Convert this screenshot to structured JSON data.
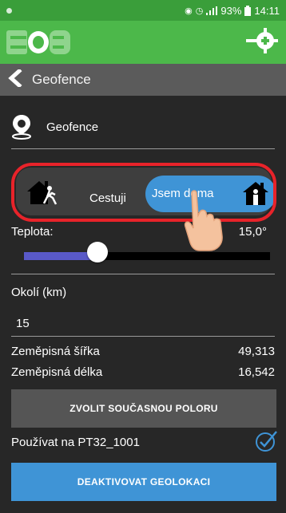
{
  "status_bar": {
    "battery": "93%",
    "time": "14:11",
    "icons": [
      "location-icon",
      "alarm-icon",
      "signal-icon",
      "battery-icon"
    ]
  },
  "app_bar": {
    "logo_icon": "eob-logo",
    "action_icon": "crosshair-icon",
    "bg_color": "#4cb84a"
  },
  "nav": {
    "back_icon": "chevron-left-icon",
    "title": "Geofence"
  },
  "geofence": {
    "icon": "location-pin-icon",
    "label": "Geofence"
  },
  "mode_toggle": {
    "option_away_label": "Cestuji",
    "option_away_icon": "house-walking-icon",
    "option_home_label": "Jsem doma",
    "option_home_icon": "house-person-icon",
    "selected": "Jsem doma",
    "highlight_color": "#e8232a",
    "active_color": "#3f94d6"
  },
  "temperature": {
    "label": "Teplota:",
    "value": "15,0°",
    "slider_fraction": 0.3
  },
  "radius": {
    "label": "Okolí (km)",
    "value": "15"
  },
  "coordinates": {
    "lat_label": "Zeměpisná šířka",
    "lat_value": "49,313",
    "lon_label": "Zeměpisná délka",
    "lon_value": "16,542"
  },
  "actions": {
    "set_position_label": "ZVOLIT SOUČASNOU POLORU",
    "use_on_label": "Používat na PT32_1001",
    "use_on_checked": true,
    "deactivate_label": "DEAKTIVOVAT GEOLOKACI"
  }
}
